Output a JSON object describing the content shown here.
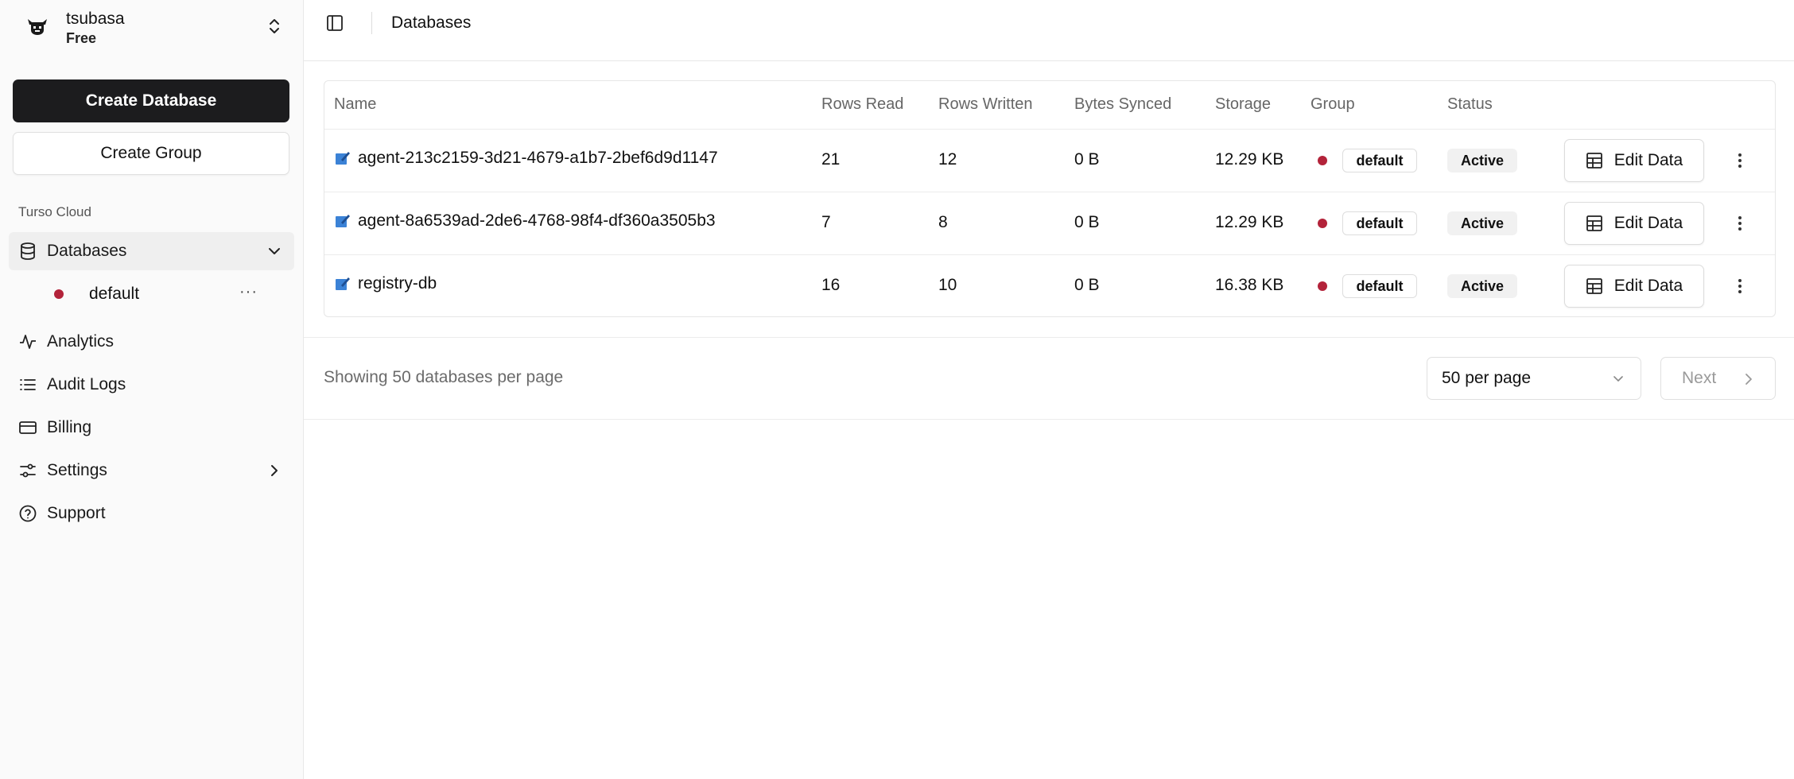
{
  "account": {
    "name": "tsubasa",
    "plan": "Free"
  },
  "sidebar": {
    "create_database_label": "Create Database",
    "create_group_label": "Create Group",
    "section_label": "Turso Cloud",
    "items": [
      {
        "label": "Databases",
        "icon": "database-icon"
      },
      {
        "label": "Analytics",
        "icon": "activity-icon"
      },
      {
        "label": "Audit Logs",
        "icon": "list-icon"
      },
      {
        "label": "Billing",
        "icon": "credit-card-icon"
      },
      {
        "label": "Settings",
        "icon": "sliders-icon"
      },
      {
        "label": "Support",
        "icon": "help-circle-icon"
      }
    ],
    "sub_item": {
      "label": "default",
      "more": "···"
    }
  },
  "header": {
    "breadcrumb": "Databases"
  },
  "table": {
    "columns": [
      "Name",
      "Rows Read",
      "Rows Written",
      "Bytes Synced",
      "Storage",
      "Group",
      "Status"
    ],
    "edit_label": "Edit Data",
    "rows": [
      {
        "name": "agent-213c2159-3d21-4679-a1b7-2bef6d9d1147",
        "rows_read": "21",
        "rows_written": "12",
        "bytes_synced": "0 B",
        "storage": "12.29 KB",
        "group": "default",
        "status": "Active"
      },
      {
        "name": "agent-8a6539ad-2de6-4768-98f4-df360a3505b3",
        "rows_read": "7",
        "rows_written": "8",
        "bytes_synced": "0 B",
        "storage": "12.29 KB",
        "group": "default",
        "status": "Active"
      },
      {
        "name": "registry-db",
        "rows_read": "16",
        "rows_written": "10",
        "bytes_synced": "0 B",
        "storage": "16.38 KB",
        "group": "default",
        "status": "Active"
      }
    ]
  },
  "footer": {
    "showing": "Showing 50 databases per page",
    "per_page": "50 per page",
    "next": "Next"
  },
  "colors": {
    "group_dot": "#b3233a",
    "primary_button": "#1c1c1e"
  }
}
